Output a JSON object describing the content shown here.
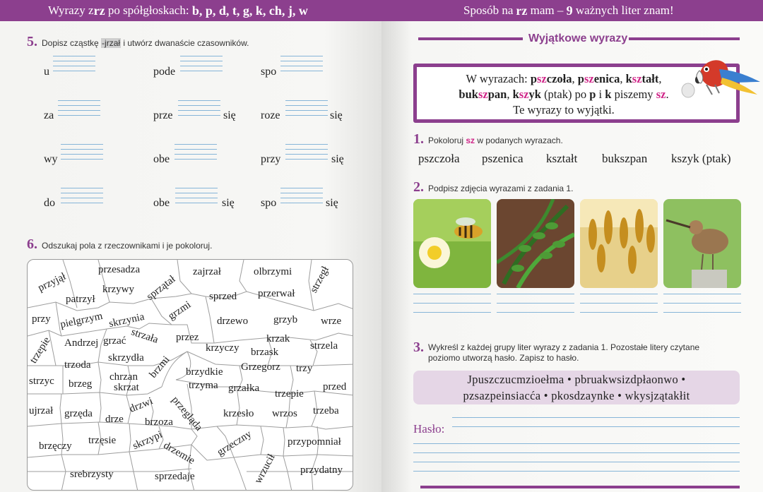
{
  "left_page": {
    "banner": {
      "prefix": "Wyrazy z ",
      "rz": "rz",
      "middle": " po spółgłoskach: ",
      "letters": "b, p, d, t, g, k, ch, j, w"
    },
    "task5": {
      "number": "5.",
      "text_before": "Dopisz cząstkę ",
      "fragment": "-jrzał",
      "text_after": " i utwórz dwanaście czasowników.",
      "rows": [
        [
          {
            "prefix": "u",
            "suffix": ""
          },
          {
            "prefix": "pode",
            "suffix": ""
          },
          {
            "prefix": "spo",
            "suffix": ""
          }
        ],
        [
          {
            "prefix": "za",
            "suffix": ""
          },
          {
            "prefix": "prze",
            "suffix": "się"
          },
          {
            "prefix": "roze",
            "suffix": "się"
          }
        ],
        [
          {
            "prefix": "wy",
            "suffix": ""
          },
          {
            "prefix": "obe",
            "suffix": ""
          },
          {
            "prefix": "przy",
            "suffix": "się"
          }
        ],
        [
          {
            "prefix": "do",
            "suffix": ""
          },
          {
            "prefix": "obe",
            "suffix": "się"
          },
          {
            "prefix": "spo",
            "suffix": "się"
          }
        ]
      ]
    },
    "task6": {
      "number": "6.",
      "text": "Odszukaj pola z rzeczownikami i je pokoloruj.",
      "words": [
        "przyjął",
        "przesadza",
        "zajrzał",
        "olbrzymi",
        "krzywy",
        "patrzył",
        "sprzątał",
        "strzegł",
        "sprzed",
        "przerwał",
        "przy",
        "pielgrzym",
        "grzmi",
        "drzewo",
        "grzyb",
        "wrze",
        "skrzynia",
        "strzała",
        "trzepie",
        "Andrzej",
        "grzać",
        "przez",
        "krzak",
        "krzyczy",
        "brzask",
        "strzela",
        "skrzydła",
        "trzoda",
        "brzmi",
        "brzydkie",
        "Grzegorz",
        "trzy",
        "strzyc",
        "brzeg",
        "chrzan",
        "skrzat",
        "trzyma",
        "grzałka",
        "trzepie",
        "przed",
        "drzwi",
        "ujrzał",
        "grzęda",
        "drze",
        "brzoza",
        "przegląda",
        "krzesło",
        "wrzos",
        "trzeba",
        "trzęsie",
        "skrzypi",
        "grzeczny",
        "przypomniał",
        "brzęczy",
        "drzemie",
        "wrzucił",
        "srebrzysty",
        "sprzedaje",
        "przydatny"
      ]
    }
  },
  "right_page": {
    "banner": {
      "prefix": "Sposób na ",
      "rz": "rz",
      "middle": " mam – ",
      "number": "9",
      "suffix": " ważnych liter znam!"
    },
    "section_title": "Wyjątkowe wyrazy",
    "rule": {
      "w1": "W wyrazach: ",
      "ex1a": "p",
      "ex1b": "sz",
      "ex1c": "czoła",
      "comma1": ", ",
      "ex2a": "p",
      "ex2b": "sz",
      "ex2c": "enica",
      "comma2": ", ",
      "ex3a": "k",
      "ex3b": "sz",
      "ex3c": "tałt",
      "comma3": ",",
      "ex4a": "buk",
      "ex4b": "sz",
      "ex4c": "pan",
      "comma4": ", ",
      "ex5a": "k",
      "ex5b": "sz",
      "ex5c": "yk",
      "mid": " (ptak) po ",
      "p": "p",
      "and": " i ",
      "k": "k",
      "write": " piszemy ",
      "sz": "sz",
      "dot": ".",
      "line3": "Te wyrazy to wyjątki."
    },
    "task1": {
      "number": "1.",
      "text_before": "Pokoloruj ",
      "sz": "sz",
      "text_after": " w podanych wyrazach.",
      "words": [
        "pszczoła",
        "pszenica",
        "kształt",
        "bukszpan",
        "kszyk (ptak)"
      ]
    },
    "task2": {
      "number": "2.",
      "text": "Podpisz zdjęcia wyrazami z zadania 1."
    },
    "task3": {
      "number": "3.",
      "text": "Wykreśl z każdej grupy liter wyrazy z zadania 1. Pozostałe litery czytane poziomo utworzą hasło. Zapisz to hasło.",
      "line1": "Jpuszczucmzioełma • pbruakwsizdpłaonwo •",
      "line2": "pzsazpeinsiacća • pkosdzaynke • wkysjzątakłit",
      "password_label": "Hasło:"
    },
    "colors": {
      "accent": "#8c3f8e",
      "highlight": "#d0288a",
      "line": "#86b5d8"
    }
  }
}
